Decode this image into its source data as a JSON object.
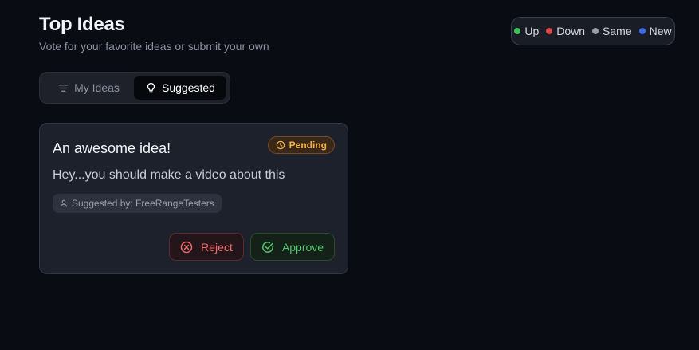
{
  "header": {
    "title": "Top Ideas",
    "subtitle": "Vote for your favorite ideas or submit your own"
  },
  "legend": {
    "items": [
      {
        "label": "Up",
        "color": "#3fbf5a"
      },
      {
        "label": "Down",
        "color": "#e04848"
      },
      {
        "label": "Same",
        "color": "#9a9ea8"
      },
      {
        "label": "New",
        "color": "#3d6ee8"
      }
    ]
  },
  "tabs": {
    "items": [
      {
        "label": "My Ideas",
        "icon": "filter-icon",
        "active": false
      },
      {
        "label": "Suggested",
        "icon": "lightbulb-icon",
        "active": true
      }
    ]
  },
  "card": {
    "title": "An awesome idea!",
    "status": "Pending",
    "status_icon": "clock-icon",
    "body": "Hey...you should make a video about this",
    "suggested_by_label": "Suggested by: FreeRangeTesters",
    "reject_label": "Reject",
    "approve_label": "Approve"
  },
  "colors": {
    "background": "#0a0c14",
    "pending": "#f2b345",
    "reject": "#ef6a6a",
    "approve": "#4cc96a"
  }
}
